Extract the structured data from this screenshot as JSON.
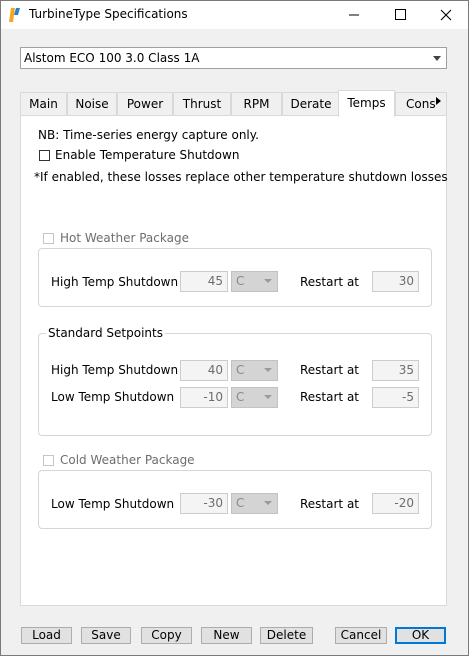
{
  "window": {
    "title": "TurbineType Specifications"
  },
  "turbine_select": {
    "value": "Alstom ECO 100 3.0 Class 1A"
  },
  "tabs": [
    {
      "label": "Main"
    },
    {
      "label": "Noise"
    },
    {
      "label": "Power"
    },
    {
      "label": "Thrust"
    },
    {
      "label": "RPM"
    },
    {
      "label": "Derate"
    },
    {
      "label": "Temps"
    },
    {
      "label": "Cons"
    }
  ],
  "active_tab": "Temps",
  "temps": {
    "note": "NB: Time-series energy capture only.",
    "enable_label": "Enable Temperature Shutdown",
    "enable_checked": false,
    "footnote": "*If enabled, these losses replace other temperature shutdown losses",
    "hot_weather": {
      "label": "Hot Weather Package",
      "checked": false,
      "high_label": "High Temp Shutdown",
      "high_value": "45",
      "high_unit": "C",
      "restart_label": "Restart at",
      "restart_value": "30"
    },
    "standard": {
      "label": "Standard Setpoints",
      "high_label": "High Temp Shutdown",
      "high_value": "40",
      "high_unit": "C",
      "high_restart_label": "Restart at",
      "high_restart_value": "35",
      "low_label": "Low Temp Shutdown",
      "low_value": "-10",
      "low_unit": "C",
      "low_restart_label": "Restart at",
      "low_restart_value": "-5"
    },
    "cold_weather": {
      "label": "Cold Weather Package",
      "checked": false,
      "low_label": "Low Temp Shutdown",
      "low_value": "-30",
      "low_unit": "C",
      "restart_label": "Restart at",
      "restart_value": "-20"
    }
  },
  "buttons": {
    "load": "Load",
    "save": "Save",
    "copy": "Copy",
    "new": "New",
    "delete": "Delete",
    "cancel": "Cancel",
    "ok": "OK"
  },
  "colors": {
    "accent": "#0078d7",
    "app_icon": "#f5a623"
  }
}
